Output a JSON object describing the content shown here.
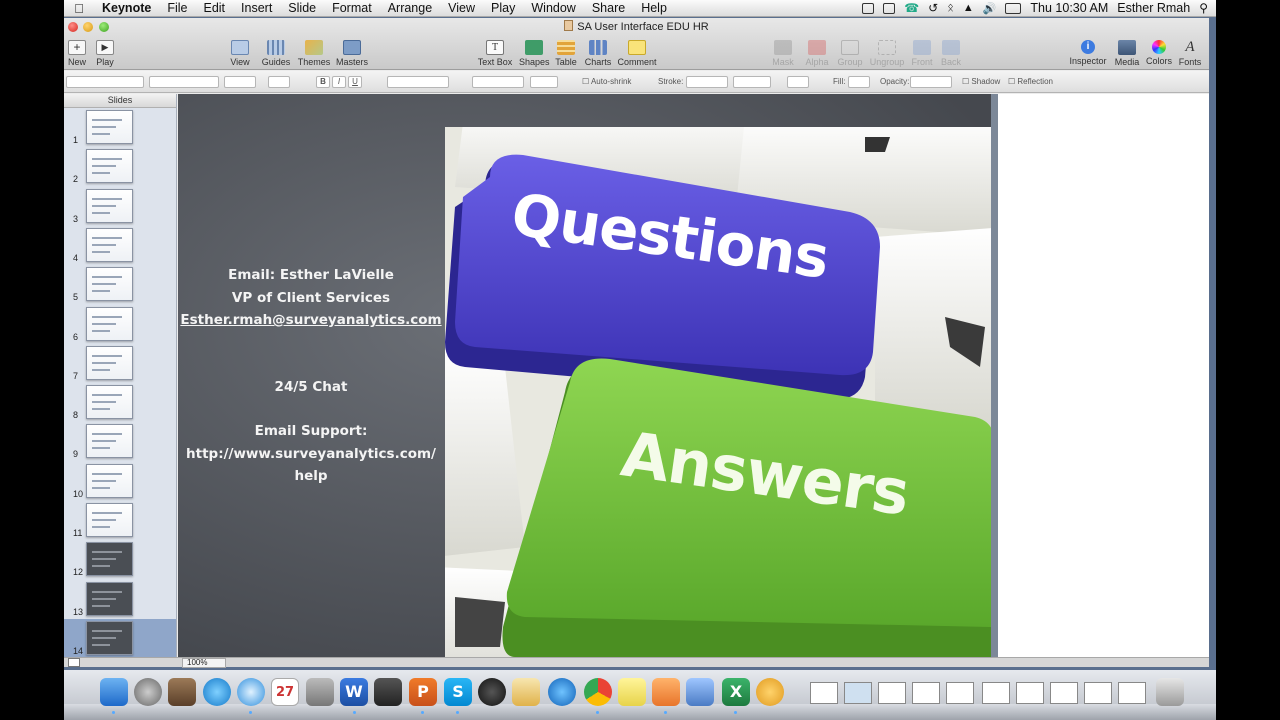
{
  "menubar": {
    "app_name": "Keynote",
    "menus": [
      "File",
      "Edit",
      "Insert",
      "Slide",
      "Format",
      "Arrange",
      "View",
      "Play",
      "Window",
      "Share",
      "Help"
    ],
    "clock": "Thu 10:30 AM",
    "user": "Esther Rmah"
  },
  "window": {
    "title": "SA User Interface EDU HR"
  },
  "toolbar": {
    "new_label": "New",
    "play_label": "Play",
    "view_label": "View",
    "guides_label": "Guides",
    "themes_label": "Themes",
    "masters_label": "Masters",
    "textbox_label": "Text Box",
    "shapes_label": "Shapes",
    "table_label": "Table",
    "charts_label": "Charts",
    "comment_label": "Comment",
    "mask_label": "Mask",
    "alpha_label": "Alpha",
    "group_label": "Group",
    "ungroup_label": "Ungroup",
    "front_label": "Front",
    "back_label": "Back",
    "inspector_label": "Inspector",
    "media_label": "Media",
    "colors_label": "Colors",
    "fonts_label": "Fonts"
  },
  "formatbar": {
    "bold": "B",
    "italic": "I",
    "underline": "U",
    "autoshrink_label": "Auto-shrink",
    "stroke_label": "Stroke:",
    "fill_label": "Fill:",
    "opacity_label": "Opacity:",
    "shadow_label": "Shadow",
    "reflection_label": "Reflection"
  },
  "sidebar": {
    "header": "Slides",
    "slides": [
      {
        "num": "1",
        "style": "light"
      },
      {
        "num": "2",
        "style": "light"
      },
      {
        "num": "3",
        "style": "light"
      },
      {
        "num": "4",
        "style": "light"
      },
      {
        "num": "5",
        "style": "light"
      },
      {
        "num": "6",
        "style": "light"
      },
      {
        "num": "7",
        "style": "light"
      },
      {
        "num": "8",
        "style": "light"
      },
      {
        "num": "9",
        "style": "light"
      },
      {
        "num": "10",
        "style": "light"
      },
      {
        "num": "11",
        "style": "light"
      },
      {
        "num": "12",
        "style": "dark"
      },
      {
        "num": "13",
        "style": "dark"
      },
      {
        "num": "14",
        "style": "dark"
      }
    ],
    "selected": "14"
  },
  "slide": {
    "email_line": "Email: Esther LaVielle",
    "role_line": "VP of Client Services",
    "email_address": "Esther.rmah@surveyanalytics.com",
    "chat_line": "24/5 Chat",
    "support_label": "Email Support:",
    "support_url": "http://www.surveyanalytics.com/",
    "support_url_tail": "help",
    "photo_key1": "Questions",
    "photo_key2": "Answers"
  },
  "statusbar": {
    "zoom": "100%"
  },
  "colors": {
    "accent_purple": "#5a4fd8",
    "accent_green": "#7cc843",
    "slide_bg": "#55595f"
  }
}
